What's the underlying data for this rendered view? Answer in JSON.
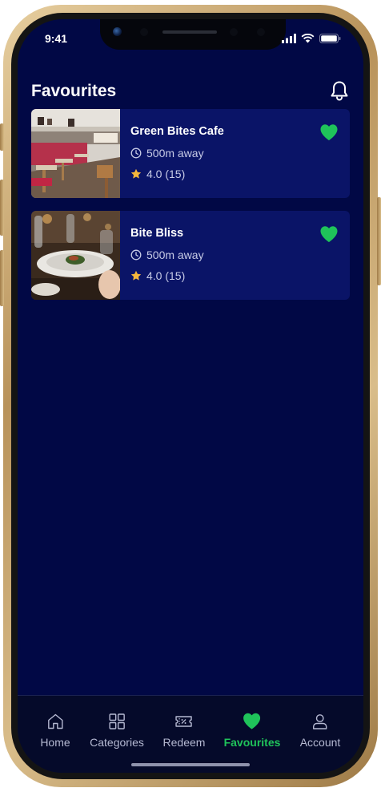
{
  "status": {
    "time": "9:41"
  },
  "header": {
    "title": "Favourites"
  },
  "favourites": [
    {
      "name": "Green Bites Cafe",
      "distance": "500m away",
      "rating": "4.0 (15)"
    },
    {
      "name": "Bite Bliss",
      "distance": "500m away",
      "rating": "4.0 (15)"
    }
  ],
  "tabs": [
    {
      "label": "Home",
      "icon": "home-icon"
    },
    {
      "label": "Categories",
      "icon": "grid-icon"
    },
    {
      "label": "Redeem",
      "icon": "coupon-icon"
    },
    {
      "label": "Favourites",
      "icon": "heart-icon",
      "active": true
    },
    {
      "label": "Account",
      "icon": "user-icon"
    }
  ],
  "colors": {
    "background": "#010845",
    "card": "#0a1467",
    "accent": "#1fc35a",
    "star": "#f5b73c"
  }
}
